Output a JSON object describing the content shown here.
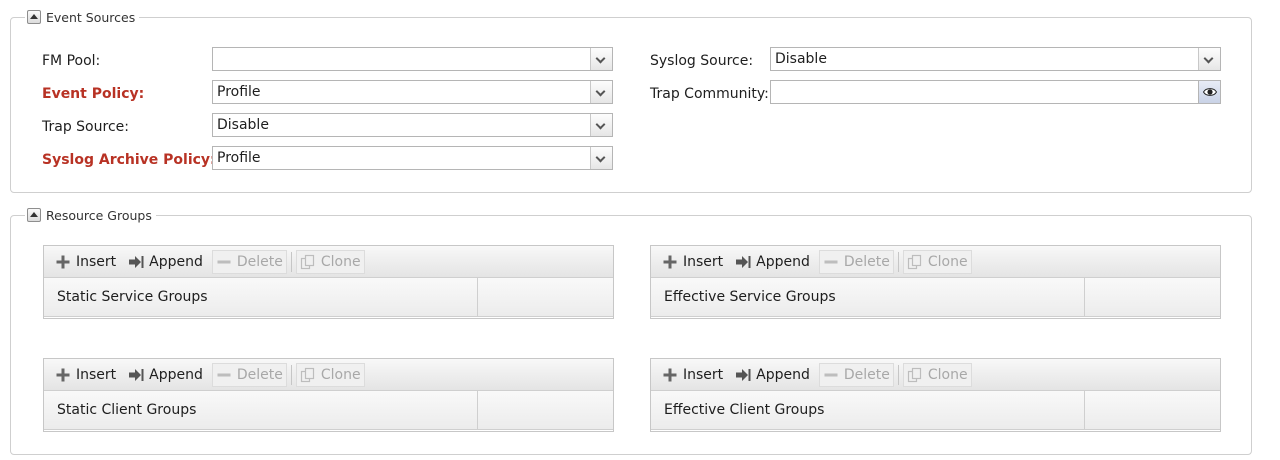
{
  "event_sources": {
    "legend": "Event Sources",
    "fm_pool": {
      "label": "FM Pool:",
      "value": ""
    },
    "event_policy": {
      "label": "Event Policy:",
      "value": "Profile"
    },
    "trap_source": {
      "label": "Trap Source:",
      "value": "Disable"
    },
    "syslog_archive_policy": {
      "label": "Syslog Archive Policy:",
      "value": "Profile"
    },
    "syslog_source": {
      "label": "Syslog Source:",
      "value": "Disable"
    },
    "trap_community": {
      "label": "Trap Community:",
      "value": ""
    }
  },
  "resource_groups": {
    "legend": "Resource Groups",
    "toolbar": {
      "insert": "Insert",
      "append": "Append",
      "delete": "Delete",
      "clone": "Clone"
    },
    "panels": [
      {
        "title": "Static Service Groups"
      },
      {
        "title": "Effective Service Groups"
      },
      {
        "title": "Static Client Groups"
      },
      {
        "title": "Effective Client Groups"
      }
    ]
  },
  "colors": {
    "required_label": "#b83224",
    "border": "#cfcfcf"
  },
  "icons": {
    "collapse": "collapse-up-icon",
    "reveal": "eye-icon",
    "insert": "plus-icon",
    "append": "append-arrow-icon",
    "delete": "minus-icon",
    "clone": "clone-icon"
  }
}
